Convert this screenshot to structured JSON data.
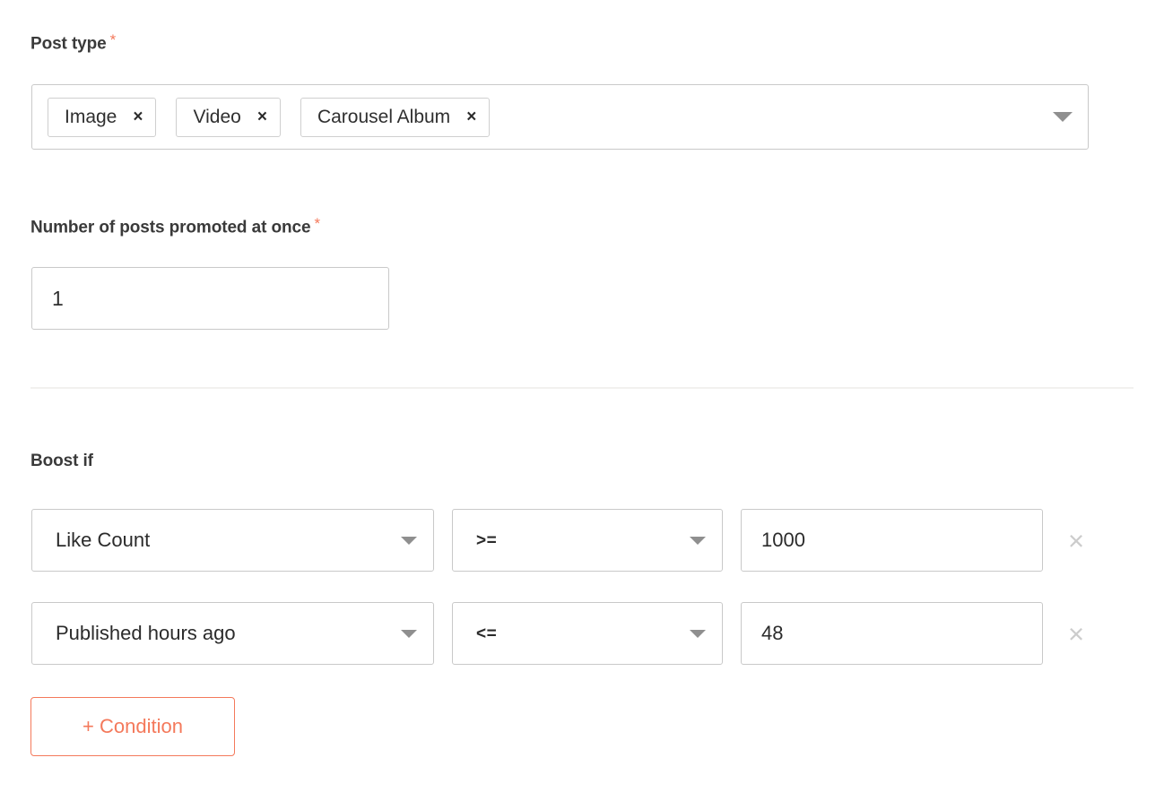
{
  "accent_color": "#f4795b",
  "border_color": "#c9c9c9",
  "divider_color": "#f2f1ef",
  "post_type": {
    "label": "Post type",
    "required_marker": "*",
    "chips": [
      {
        "label": "Image",
        "remove_glyph": "×"
      },
      {
        "label": "Video",
        "remove_glyph": "×"
      },
      {
        "label": "Carousel Album",
        "remove_glyph": "×"
      }
    ],
    "dropdown_icon": "caret-down-icon"
  },
  "posts_promoted": {
    "label": "Number of posts promoted at once",
    "required_marker": "*",
    "value": "1",
    "placeholder": ""
  },
  "boost_if": {
    "label": "Boost if",
    "conditions": [
      {
        "field": "Like Count",
        "operator": ">=",
        "value": "1000",
        "remove_glyph": "×"
      },
      {
        "field": "Published hours ago",
        "operator": "<=",
        "value": "48",
        "remove_glyph": "×"
      }
    ],
    "add_condition_label": "+ Condition"
  }
}
